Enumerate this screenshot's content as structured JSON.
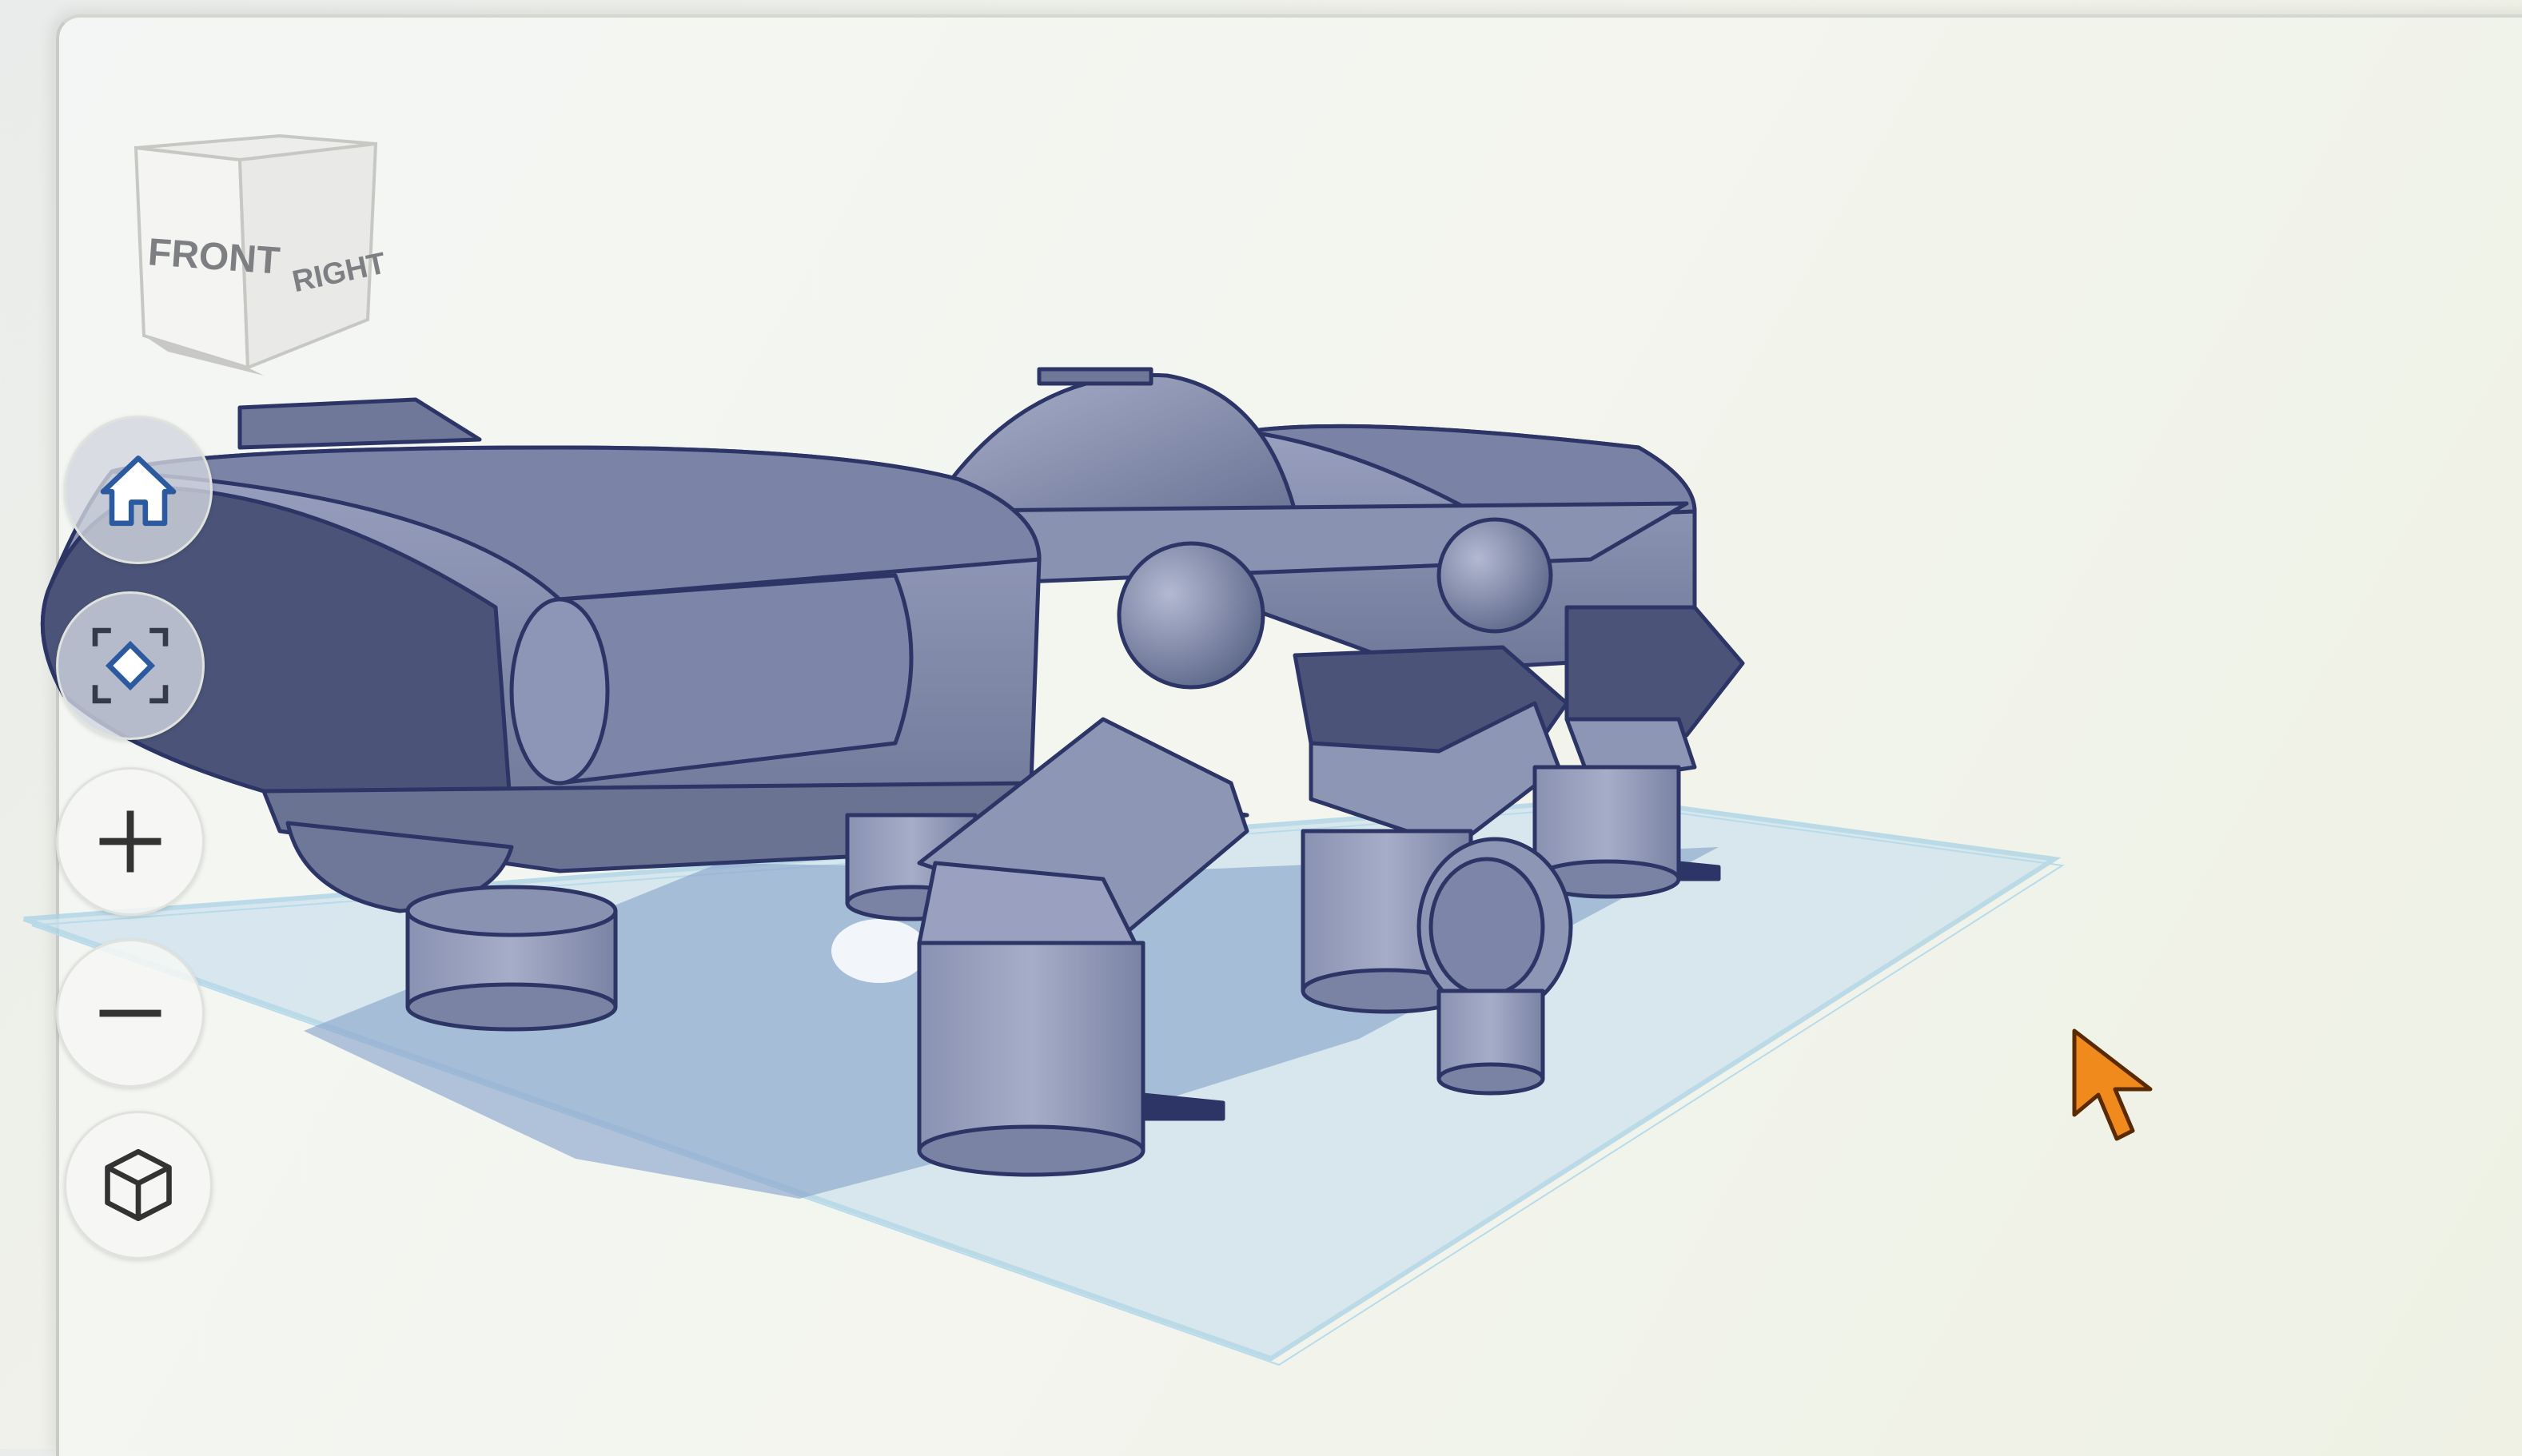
{
  "viewcube": {
    "front_label": "FRONT",
    "right_label": "RIGHT"
  },
  "navigation": {
    "home": {
      "icon": "home-icon"
    },
    "fit": {
      "icon": "fit-view-icon"
    },
    "zoom_in": {
      "icon": "plus-icon"
    },
    "zoom_out": {
      "icon": "minus-icon"
    },
    "projection": {
      "icon": "perspective-cube-icon"
    }
  },
  "colors": {
    "model_fill": "#7d86a8",
    "model_dark": "#4b5478",
    "model_edge": "#2c3566",
    "workplane": "#cfe3ee",
    "workplane_edge": "#a9d2e6",
    "shadow": "#8ca6cc",
    "cursor": "#f08a1c"
  }
}
